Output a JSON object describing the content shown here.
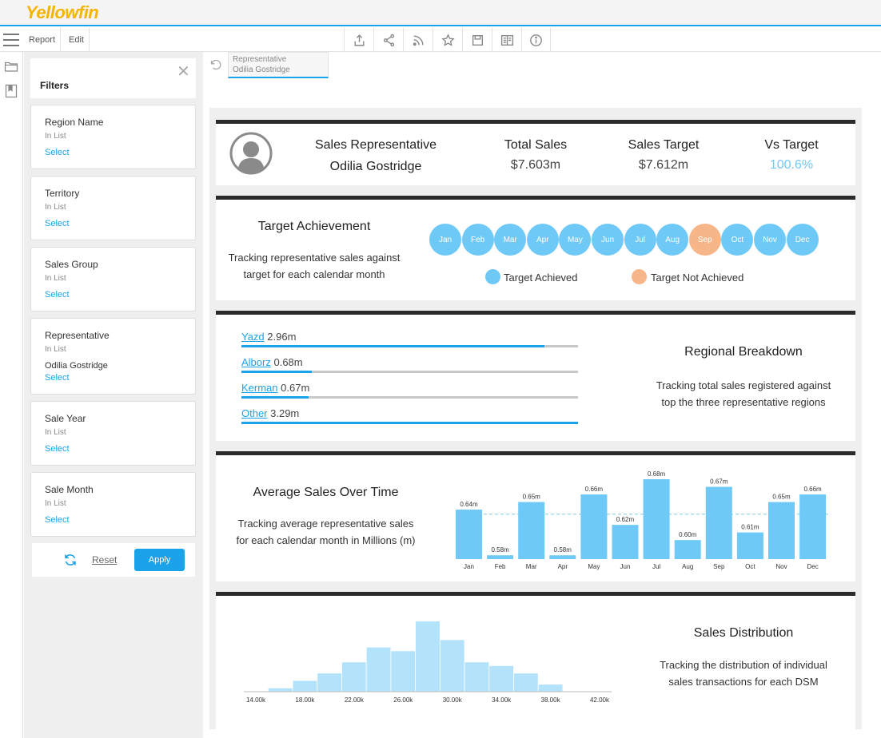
{
  "app": {
    "logo_text": "Yellowfin"
  },
  "toolbar": {
    "report_label": "Report",
    "edit_label": "Edit",
    "icons": [
      "export-icon",
      "share-icon",
      "rss-icon",
      "star-icon",
      "save-icon",
      "storyboard-icon",
      "info-icon"
    ]
  },
  "filters": {
    "title": "Filters",
    "items": [
      {
        "name": "Region Name",
        "operator": "In List",
        "value": "",
        "select_label": "Select"
      },
      {
        "name": "Territory",
        "operator": "In List",
        "value": "",
        "select_label": "Select"
      },
      {
        "name": "Sales Group",
        "operator": "In List",
        "value": "",
        "select_label": "Select"
      },
      {
        "name": "Representative",
        "operator": "In List",
        "value": "Odilia Gostridge",
        "select_label": "Select"
      },
      {
        "name": "Sale Year",
        "operator": "In List",
        "value": "",
        "select_label": "Select"
      },
      {
        "name": "Sale Month",
        "operator": "In List",
        "value": "",
        "select_label": "Select"
      }
    ],
    "reset_label": "Reset",
    "apply_label": "Apply"
  },
  "breadcrumb": {
    "line1": "Representative",
    "line2": "Odilia Gostridge"
  },
  "kpi": {
    "rep_title": "Sales Representative",
    "rep_name": "Odilia Gostridge",
    "total_sales_title": "Total Sales",
    "total_sales_value": "$7.603m",
    "sales_target_title": "Sales Target",
    "sales_target_value": "$7.612m",
    "vs_target_title": "Vs Target",
    "vs_target_value": "100.6%"
  },
  "target": {
    "title": "Target Achievement",
    "desc_line1": "Tracking representative sales against",
    "desc_line2": "target for each calendar month",
    "months": [
      {
        "label": "Jan",
        "achieved": true
      },
      {
        "label": "Feb",
        "achieved": true
      },
      {
        "label": "Mar",
        "achieved": true
      },
      {
        "label": "Apr",
        "achieved": true
      },
      {
        "label": "May",
        "achieved": true
      },
      {
        "label": "Jun",
        "achieved": true
      },
      {
        "label": "Jul",
        "achieved": true
      },
      {
        "label": "Aug",
        "achieved": true
      },
      {
        "label": "Sep",
        "achieved": false
      },
      {
        "label": "Oct",
        "achieved": true
      },
      {
        "label": "Nov",
        "achieved": true
      },
      {
        "label": "Dec",
        "achieved": true
      }
    ],
    "legend_achieved": "Target Achieved",
    "legend_not_achieved": "Target Not Achieved",
    "color_achieved": "#6fc9f7",
    "color_not_achieved": "#f7b58a"
  },
  "regional": {
    "title": "Regional Breakdown",
    "desc_line1": "Tracking total sales registered against",
    "desc_line2": "top the three representative regions",
    "items": [
      {
        "name": "Yazd",
        "value_label": "2.96m",
        "fraction": 0.9
      },
      {
        "name": "Alborz",
        "value_label": "0.68m",
        "fraction": 0.21
      },
      {
        "name": "Kerman",
        "value_label": "0.67m",
        "fraction": 0.2
      },
      {
        "name": "Other",
        "value_label": "3.29m",
        "fraction": 1.0
      }
    ]
  },
  "avg_sales": {
    "title": "Average Sales Over Time",
    "desc_line1": "Tracking average representative sales",
    "desc_line2": "for each calendar month in Millions (m)"
  },
  "distribution": {
    "title": "Sales Distribution",
    "desc_line1": "Tracking the distribution of individual",
    "desc_line2": "sales transactions for each DSM"
  },
  "chart_data": [
    {
      "type": "bar",
      "categories": [
        "Jan",
        "Feb",
        "Mar",
        "Apr",
        "May",
        "Jun",
        "Jul",
        "Aug",
        "Sep",
        "Oct",
        "Nov",
        "Dec"
      ],
      "values": [
        0.64,
        0.58,
        0.65,
        0.58,
        0.66,
        0.62,
        0.68,
        0.6,
        0.67,
        0.61,
        0.65,
        0.66
      ],
      "data_labels": [
        "0.64m",
        "0.58m",
        "0.65m",
        "0.58m",
        "0.66m",
        "0.62m",
        "0.68m",
        "0.60m",
        "0.67m",
        "0.61m",
        "0.65m",
        "0.66m"
      ],
      "ylim": [
        0.575,
        0.68
      ],
      "reference_line": 0.634,
      "color": "#6fc9f7"
    },
    {
      "type": "bar",
      "x_ticks": [
        "14.00k",
        "18.00k",
        "22.00k",
        "26.00k",
        "30.00k",
        "34.00k",
        "38.00k",
        "42.00k"
      ],
      "xlim": [
        14000,
        42000
      ],
      "bin_start": 15000,
      "bin_width": 2000,
      "counts": [
        1,
        3,
        5,
        8,
        12,
        11,
        19,
        14,
        8,
        7,
        5,
        2
      ],
      "ylim": [
        0,
        20
      ],
      "color": "#b3e2fb"
    }
  ]
}
